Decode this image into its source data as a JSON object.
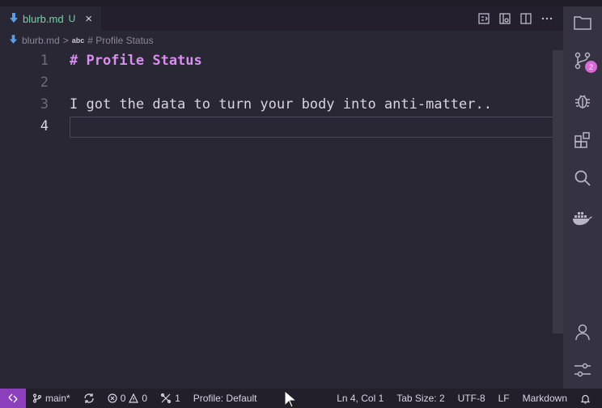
{
  "tab": {
    "filename": "blurb.md",
    "git_status": "U",
    "close_glyph": "×"
  },
  "breadcrumb": {
    "file": "blurb.md",
    "separator": ">",
    "symbol_kind": "abc",
    "symbol": "# Profile Status"
  },
  "editor": {
    "lines": [
      {
        "number": "1",
        "text": "# Profile Status"
      },
      {
        "number": "2",
        "text": ""
      },
      {
        "number": "3",
        "text": "I got the data to turn your body into anti-matter.."
      },
      {
        "number": "4",
        "text": ""
      }
    ]
  },
  "activity": {
    "scm_badge": "2"
  },
  "statusbar": {
    "branch": "main*",
    "errors": "0",
    "warnings": "0",
    "ports": "1",
    "profile": "Profile: Default",
    "position": "Ln 4, Col 1",
    "tab_size": "Tab Size: 2",
    "encoding": "UTF-8",
    "eol": "LF",
    "language": "Markdown"
  },
  "colors": {
    "accent": "#d76ad6",
    "remote": "#8c3fbd",
    "heading": "#d98df0",
    "untracked": "#6fd5a0"
  }
}
